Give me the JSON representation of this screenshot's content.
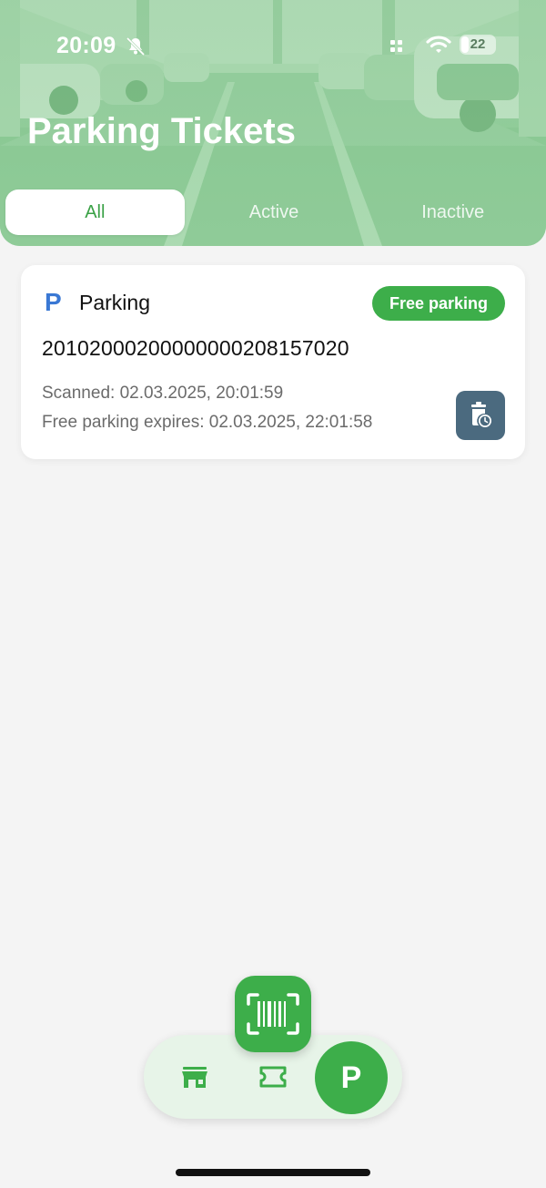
{
  "status_bar": {
    "time": "20:09",
    "battery": "22",
    "battery_level": 0.22
  },
  "header": {
    "title": "Parking Tickets"
  },
  "tabs": [
    {
      "label": "All",
      "selected": true
    },
    {
      "label": "Active",
      "selected": false
    },
    {
      "label": "Inactive",
      "selected": false
    }
  ],
  "ticket": {
    "type_label": "Parking",
    "badge": "Free parking",
    "number": "20102000200000000208157020",
    "scanned": "Scanned: 02.03.2025, 20:01:59",
    "expires": "Free parking expires: 02.03.2025, 22:01:58",
    "icon_letter": "P"
  },
  "bottom_nav": {
    "items": [
      {
        "icon": "shop-icon"
      },
      {
        "icon": "ticket-icon"
      },
      {
        "icon": "parking-icon",
        "label": "P",
        "selected": true
      }
    ],
    "scan_icon": "barcode-scan-icon"
  },
  "colors": {
    "accent": "#3dae4a",
    "parking_blue": "#3a78d4",
    "history_button": "#4b6a7f"
  }
}
